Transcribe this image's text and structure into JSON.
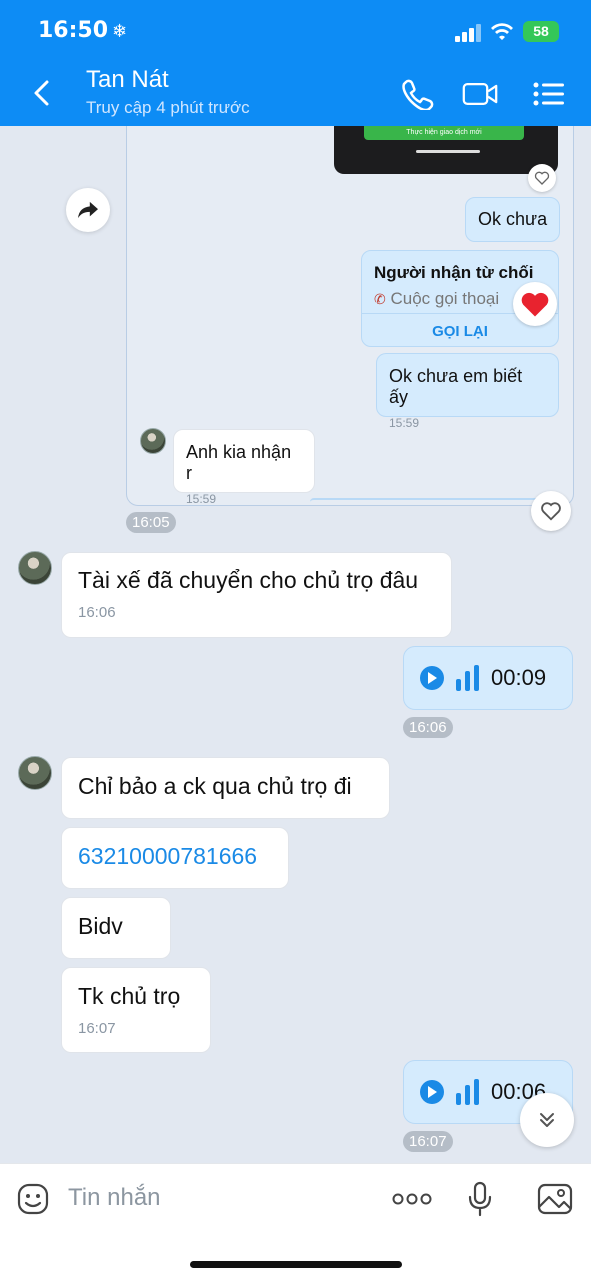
{
  "status_bar": {
    "time": "16:50",
    "snow": "❄",
    "battery": "58"
  },
  "header": {
    "name": "Tan Nát",
    "status": "Truy cập 4 phút trước"
  },
  "quoted": {
    "thumb_text": "Thực hiện giao dịch mới",
    "ok_chua": "Ok chưa",
    "call_title": "Người nhận từ chối",
    "call_sub": "Cuộc gọi thoại",
    "call_again": "GỌI LẠI",
    "ok_chua_em": "Ok chưa em biết ấy",
    "ok_chua_em_time": "15:59",
    "anh_kia": "Anh kia nhận r",
    "anh_kia_time": "15:59"
  },
  "messages": {
    "pill_1605": "16:05",
    "m1_text": "Tài xế đã chuyển cho chủ trọ đâu",
    "m1_time": "16:06",
    "v1_dur": "00:09",
    "pill_1606": "16:06",
    "m2_text": "Chỉ bảo a ck qua chủ trọ đi",
    "m3_text": "63210000781666",
    "m4_text": "Bidv",
    "m5_text": "Tk chủ trọ",
    "m5_time": "16:07",
    "v2_dur": "00:06",
    "pill_1607": "16:07"
  },
  "composer": {
    "placeholder": "Tin nhắn"
  },
  "colors": {
    "accent": "#0d8cf5",
    "link": "#1a8ae6",
    "heart": "#e8232f"
  }
}
